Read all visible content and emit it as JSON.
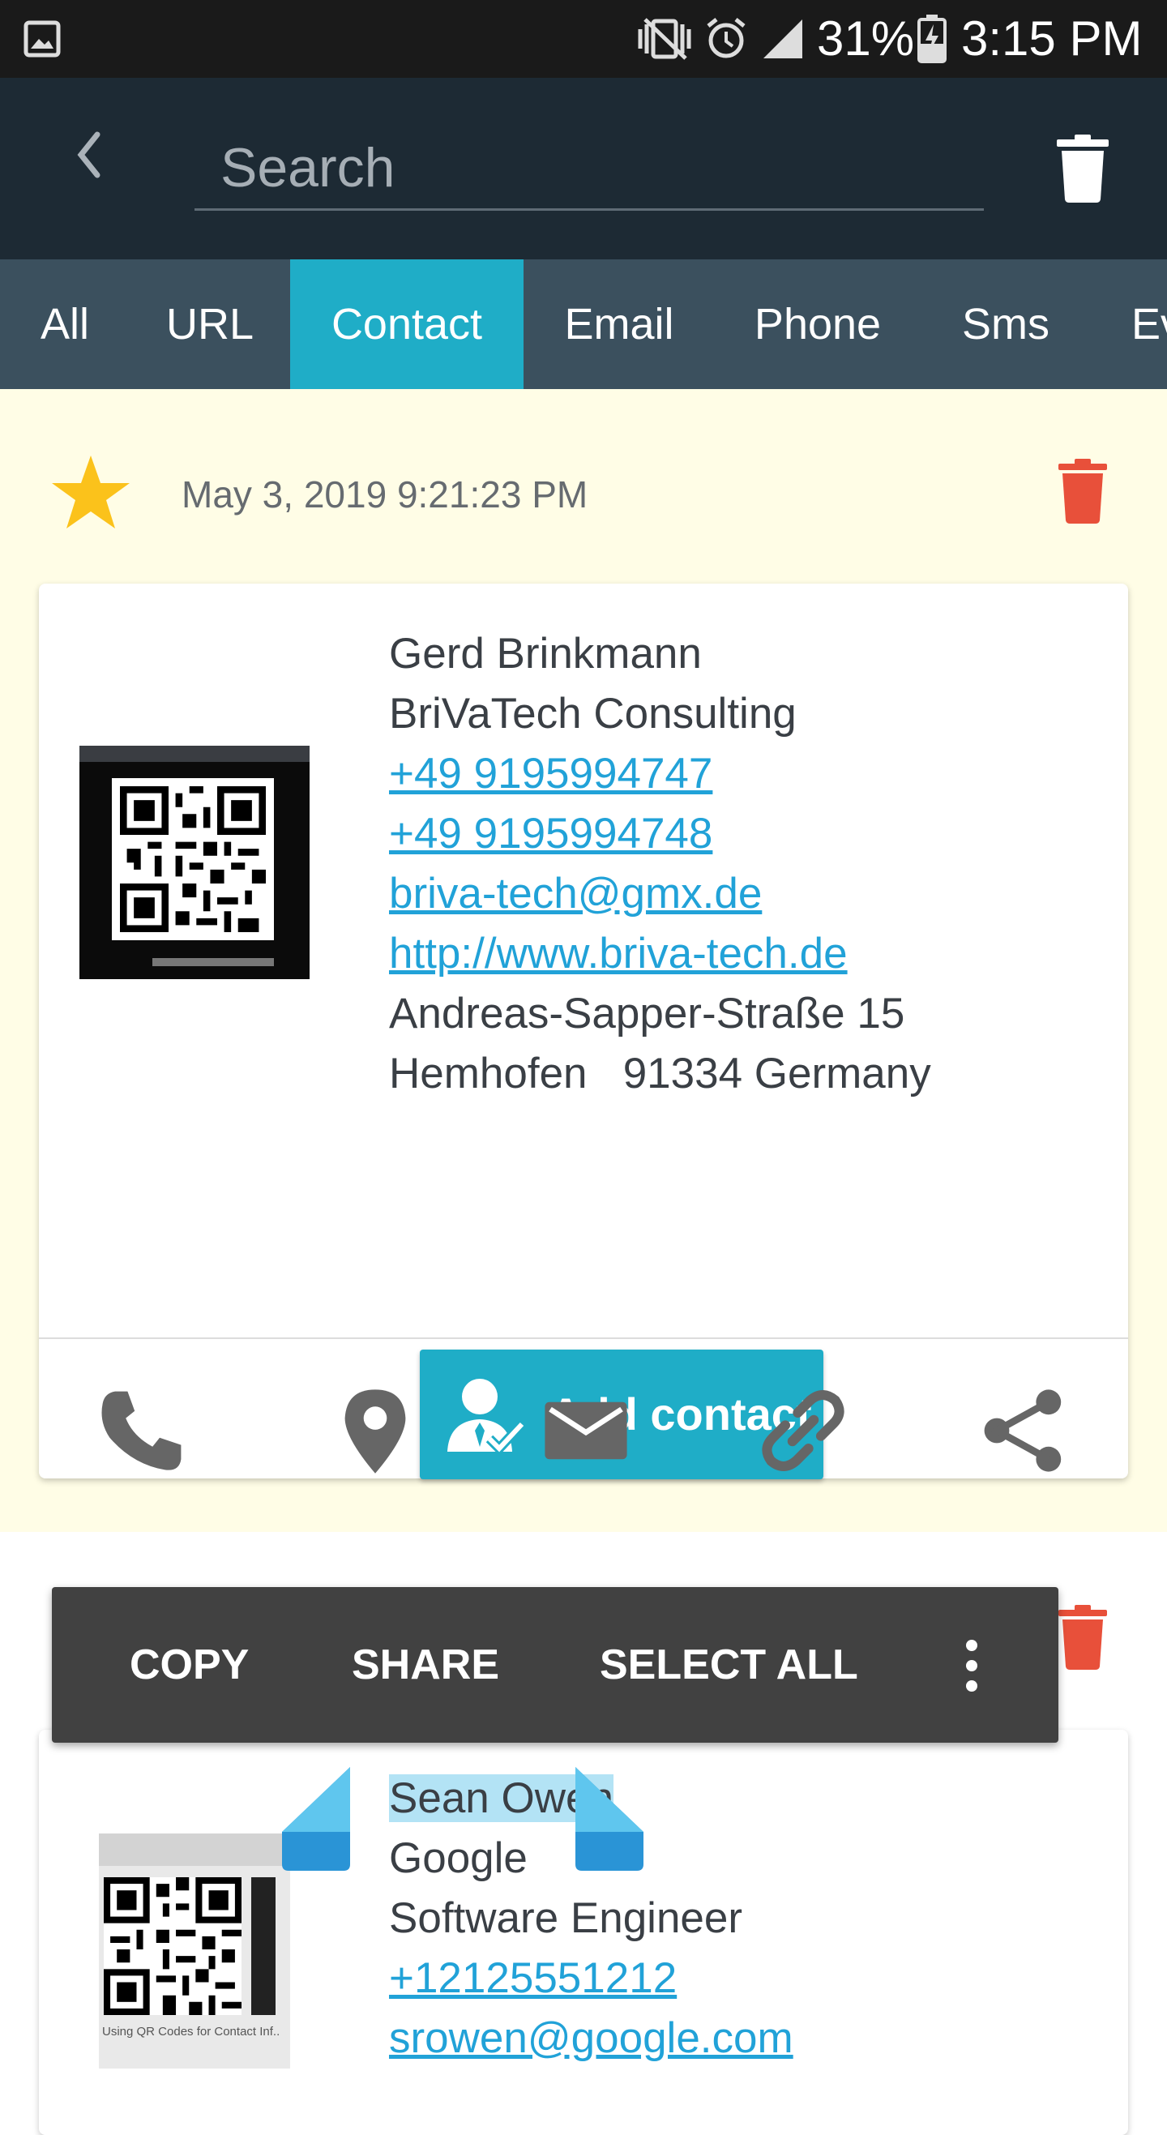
{
  "status_bar": {
    "battery": "31%",
    "time": "3:15 PM"
  },
  "search": {
    "placeholder": "Search",
    "value": ""
  },
  "tabs": [
    {
      "label": "All"
    },
    {
      "label": "URL"
    },
    {
      "label": "Contact",
      "active": true
    },
    {
      "label": "Email"
    },
    {
      "label": "Phone"
    },
    {
      "label": "Sms"
    },
    {
      "label": "Ev"
    }
  ],
  "card1": {
    "favorite": true,
    "timestamp": "May 3, 2019 9:21:23 PM",
    "lines": [
      {
        "text": "Gerd Brinkmann",
        "link": false
      },
      {
        "text": "BriVaTech Consulting",
        "link": false
      },
      {
        "text": "+49 9195994747",
        "link": true
      },
      {
        "text": "+49 9195994748",
        "link": true
      },
      {
        "text": "briva-tech@gmx.de",
        "link": true
      },
      {
        "text": "http://www.briva-tech.de",
        "link": true
      },
      {
        "text": "Andreas-Sapper-Straße 15",
        "link": false
      },
      {
        "text": "Hemhofen   91334 Germany",
        "link": false
      }
    ],
    "add_contact_label": "Add contact",
    "actions": [
      "phone-icon",
      "location-pin-icon",
      "mail-icon",
      "link-icon",
      "share-icon"
    ]
  },
  "context_menu": {
    "copy": "COPY",
    "share": "SHARE",
    "select_all": "SELECT ALL"
  },
  "card2": {
    "lines": [
      {
        "text": "Sean Owen",
        "link": false,
        "selected": true
      },
      {
        "text": "Google",
        "link": false
      },
      {
        "text": "Software Engineer",
        "link": false
      },
      {
        "text": "+12125551212",
        "link": true
      },
      {
        "text": "srowen@google.com",
        "link": true
      }
    ],
    "qr_caption": "Using QR Codes for Contact Inf..."
  },
  "colors": {
    "accent": "#1fadc7",
    "toolbar": "#1d2a34",
    "tabs": "#3b505e",
    "delete": "#e8503a",
    "star": "#fbc21b",
    "card_bg": "#fffde6",
    "link": "#21a2d8"
  }
}
